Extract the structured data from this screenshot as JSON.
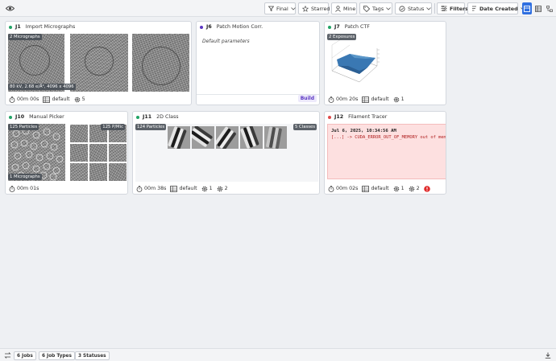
{
  "toolbar": {
    "final_label": "Final",
    "starred_label": "Starred",
    "mine_label": "Mine",
    "tags_label": "Tags",
    "status_label": "Status",
    "filters_label": "Filters",
    "sort_label": "Date Created"
  },
  "jobs": [
    {
      "id": "J1",
      "title": "Import Micrographs",
      "status_color": "#21a366",
      "badge": "2 Micrographs",
      "info": "80 kV, 2.68 e/Å², 4096 x 4096",
      "time": "00m 00s",
      "lane": "default",
      "count": "5"
    },
    {
      "id": "J6",
      "title": "Patch Motion Corr.",
      "status_color": "#5b36c2",
      "params": "Default parameters",
      "action": "Build"
    },
    {
      "id": "J7",
      "title": "Patch CTF",
      "status_color": "#21a366",
      "badge": "2 Exposures",
      "time": "00m 20s",
      "lane": "default",
      "count": "1"
    },
    {
      "id": "J10",
      "title": "Manual Picker",
      "status_color": "#21a366",
      "badge": "125 Particles",
      "badge2": "1 Micrographs",
      "badge3": "125 P/Mic",
      "time": "00m 01s"
    },
    {
      "id": "J11",
      "title": "2D Class",
      "status_color": "#21a366",
      "badge": "124 Particles",
      "badge2": "5 Classes",
      "time": "00m 38s",
      "lane": "default",
      "count": "1",
      "count2": "2"
    },
    {
      "id": "J12",
      "title": "Filament Tracer",
      "status_color": "#e04a4a",
      "error_date": "Jul 6, 2025, 10:34:56 AM",
      "error_msg": "[...] -> CUDA_ERROR_OUT_OF_MEMORY out of memory",
      "time": "00m 02s",
      "lane": "default",
      "count": "1",
      "count2": "2"
    }
  ],
  "statusbar": {
    "jobs_count": "6",
    "jobs_label": "Jobs",
    "job_types_count": "6",
    "job_types_label": "Job Types",
    "statuses_count": "3",
    "statuses_label": "Statuses"
  },
  "colors": {
    "primary": "#2f6fe0",
    "success": "#21a366",
    "building": "#5b36c2",
    "failed": "#e04a4a"
  }
}
